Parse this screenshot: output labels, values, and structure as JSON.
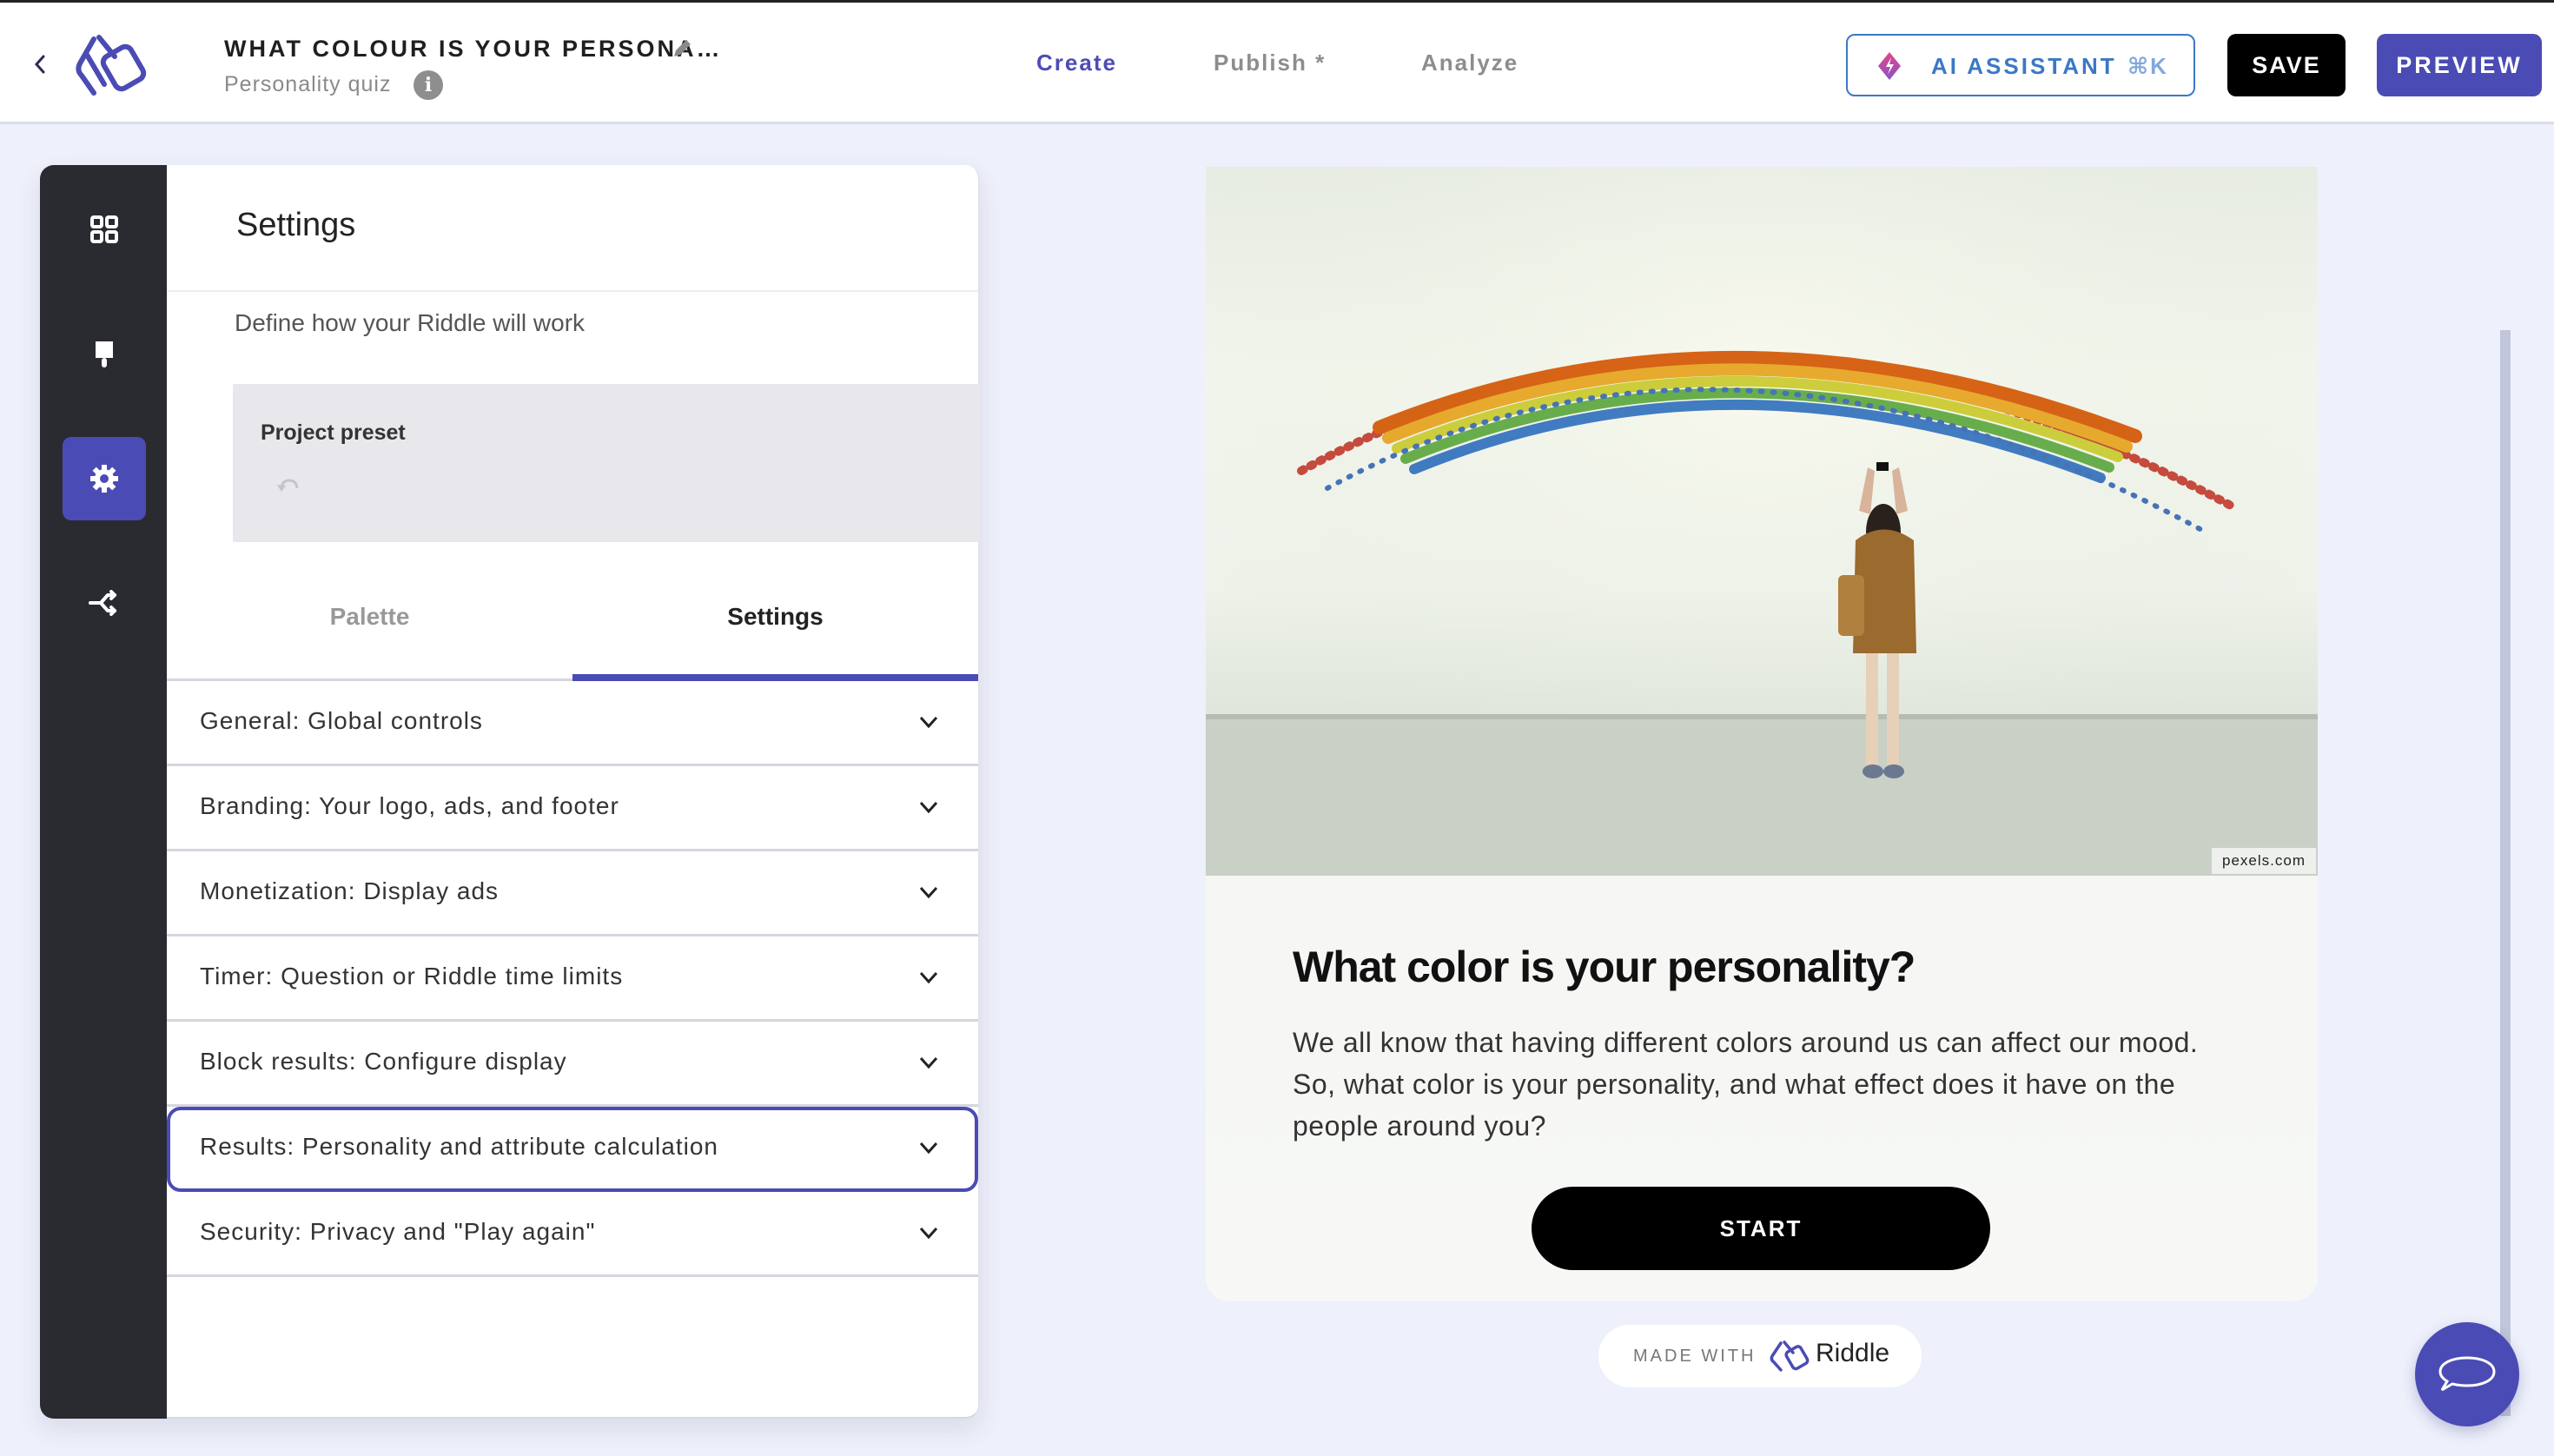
{
  "header": {
    "title": "WHAT COLOUR IS YOUR PERSONA…",
    "subtitle": "Personality quiz",
    "info_glyph": "i",
    "nav": [
      {
        "label": "Create",
        "active": true
      },
      {
        "label": "Publish *",
        "active": false
      },
      {
        "label": "Analyze",
        "active": false
      }
    ],
    "ai_assistant_label": "AI ASSISTANT",
    "ai_assistant_shortcut": "⌘K",
    "save_label": "SAVE",
    "preview_label": "PREVIEW"
  },
  "rail": {
    "items": [
      {
        "icon": "grid-icon",
        "active": false
      },
      {
        "icon": "paint-brush-icon",
        "active": false
      },
      {
        "icon": "gear-icon",
        "active": true
      },
      {
        "icon": "share-icon",
        "active": false
      }
    ]
  },
  "panel": {
    "title": "Settings",
    "description": "Define how your Riddle will work",
    "preset_label": "Project preset",
    "tabs": [
      {
        "label": "Palette",
        "active": false
      },
      {
        "label": "Settings",
        "active": true
      }
    ],
    "sections": [
      {
        "label": "General: Global controls"
      },
      {
        "label": "Branding: Your logo, ads, and footer"
      },
      {
        "label": "Monetization: Display ads"
      },
      {
        "label": "Timer: Question or Riddle time limits"
      },
      {
        "label": "Block results: Configure display"
      },
      {
        "label": "Results: Personality and attribute calculation",
        "focused": true
      },
      {
        "label": "Security: Privacy and \"Play again\""
      }
    ]
  },
  "preview": {
    "image_credit": "pexels.com",
    "title": "What color is your personality?",
    "description": "We all know that having different colors around us can affect our mood. So, what color is your personality, and what effect does it have on the people around you?",
    "start_label": "START",
    "made_with_label": "MADE WITH",
    "brand": "Riddle"
  },
  "colors": {
    "accent": "#4b4bb5",
    "ai_blue": "#3b78c4",
    "rail_bg": "#2a2b31",
    "page_bg": "#eef1fb"
  }
}
